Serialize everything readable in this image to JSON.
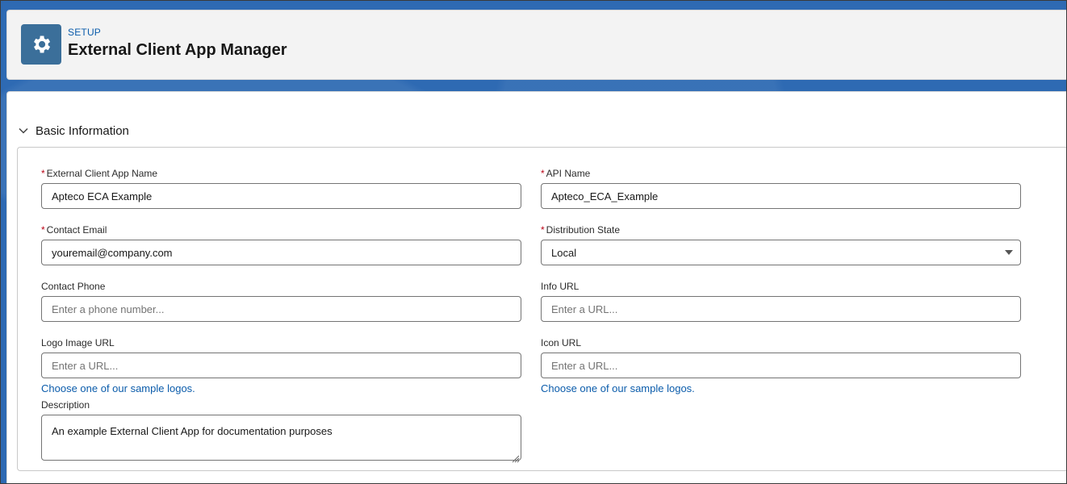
{
  "header": {
    "breadcrumb": "SETUP",
    "title": "External Client App Manager",
    "icon": "gear-icon"
  },
  "section": {
    "title": "Basic Information",
    "expanded": true
  },
  "fields": {
    "app_name": {
      "label": "External Client App Name",
      "required": true,
      "value": "Apteco ECA Example"
    },
    "api_name": {
      "label": "API Name",
      "required": true,
      "value": "Apteco_ECA_Example"
    },
    "contact_email": {
      "label": "Contact Email",
      "required": true,
      "value": "youremail@company.com"
    },
    "distribution_state": {
      "label": "Distribution State",
      "required": true,
      "value": "Local"
    },
    "contact_phone": {
      "label": "Contact Phone",
      "required": false,
      "value": "",
      "placeholder": "Enter a phone number..."
    },
    "info_url": {
      "label": "Info URL",
      "required": false,
      "value": "",
      "placeholder": "Enter a URL..."
    },
    "logo_image_url": {
      "label": "Logo Image URL",
      "required": false,
      "value": "",
      "placeholder": "Enter a URL...",
      "link": "Choose one of our sample logos."
    },
    "icon_url": {
      "label": "Icon URL",
      "required": false,
      "value": "",
      "placeholder": "Enter a URL...",
      "link": "Choose one of our sample logos."
    },
    "description": {
      "label": "Description",
      "required": false,
      "value": "An example External Client App for documentation purposes"
    }
  },
  "required_marker": "*",
  "colors": {
    "link": "#0b5cab",
    "required": "#ba0517",
    "header_icon_bg": "#3b6f9a",
    "background": "#2e6ab3"
  }
}
